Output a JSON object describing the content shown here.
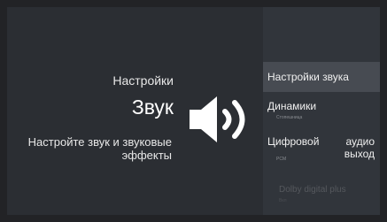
{
  "header": {
    "breadcrumb": "Настройки",
    "title": "Звук",
    "description": "Настройте звук и звуковые эффекты",
    "icon": "speaker-volume-icon"
  },
  "menu": {
    "items": [
      {
        "label": "Настройки звука",
        "sub": "",
        "state": "focused"
      },
      {
        "label": "Динамики",
        "sub": "Стопешница",
        "state": "normal"
      },
      {
        "label": "Цифровой аудио выход",
        "sub": "PCM",
        "state": "normal"
      },
      {
        "label": "Dolby digital plus",
        "sub": "Вкл",
        "state": "disabled"
      }
    ]
  },
  "colors": {
    "background": "#2b2e33",
    "panel": "#31353b",
    "focused_item": "#474b52",
    "text": "#e8e8e8"
  }
}
